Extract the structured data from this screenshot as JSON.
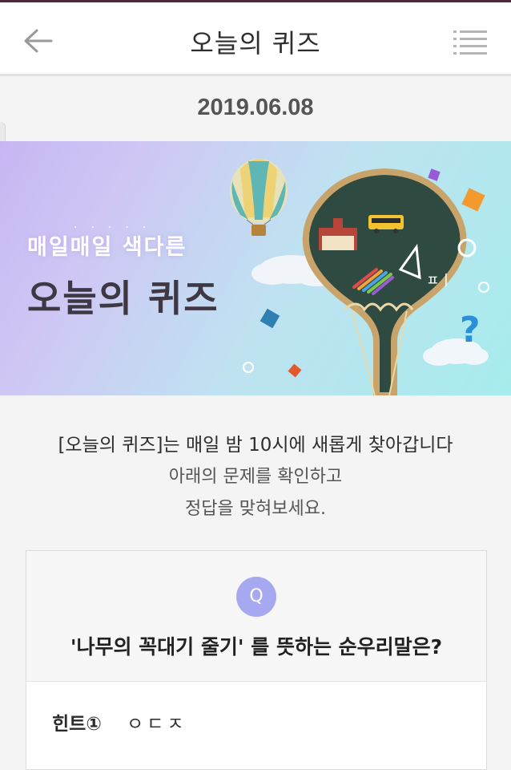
{
  "header": {
    "title": "오늘의 퀴즈",
    "back_icon": "arrow-left-icon",
    "menu_icon": "hamburger-menu-icon"
  },
  "date": "2019.06.08",
  "banner": {
    "subtitle": "매일매일 색다른",
    "title": "오늘의 퀴즈"
  },
  "intro": {
    "line1": "[오늘의 퀴즈]는 매일 밤 10시에 새롭게 찾아갑니다",
    "line2": "아래의 문제를 확인하고",
    "line3": "정답을 맞혀보세요."
  },
  "quiz": {
    "badge": "Q",
    "question": "'나무의 꼭대기 줄기' 를 뜻하는 순우리말은?",
    "hint_label": "힌트①",
    "hint_value": "ㅇㄷㅈ"
  },
  "colors": {
    "accent": "#a7a9f0",
    "hint_highlight": "#fde57f",
    "top_bar": "#4a2b3e"
  }
}
